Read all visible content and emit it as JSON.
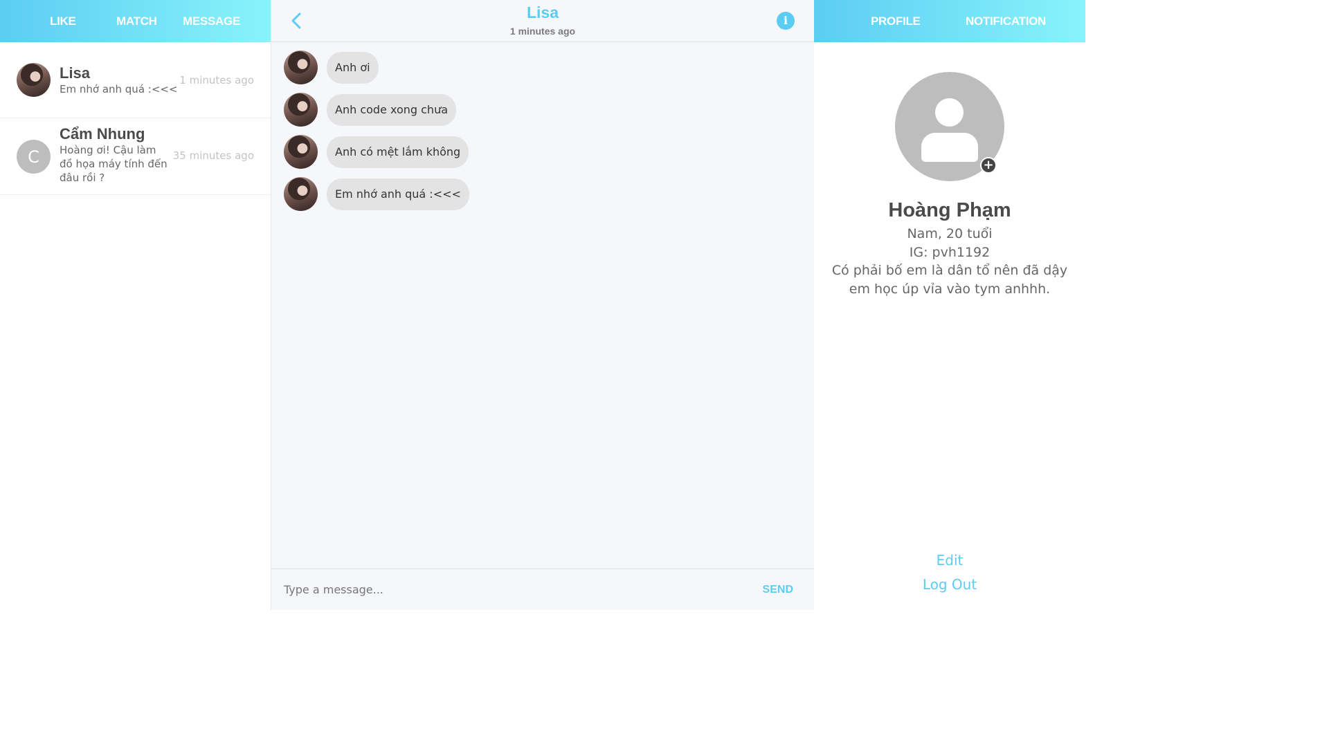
{
  "nav_left": {
    "like": "LIKE",
    "match": "MATCH",
    "message": "MESSAGE"
  },
  "nav_right": {
    "profile": "PROFILE",
    "notification": "NOTIFICATION"
  },
  "conversations": [
    {
      "name": "Lisa",
      "last_message": "Em nhớ anh quá :<<<",
      "time": "1 minutes ago",
      "avatar": "photo"
    },
    {
      "name": "Cẩm Nhung",
      "last_message": "Hoàng ơi! Cậu làm đồ họa máy tính đến đâu rồi ?",
      "time": "35 minutes ago",
      "avatar_letter": "C"
    }
  ],
  "chat": {
    "title": "Lisa",
    "subtitle": "1 minutes ago",
    "messages": [
      {
        "text": "Anh ơi"
      },
      {
        "text": "Anh code xong chưa"
      },
      {
        "text": "Anh có mệt lắm không"
      },
      {
        "text": "Em nhớ anh quá :<<<"
      }
    ],
    "input_placeholder": "Type a message...",
    "send_label": "SEND"
  },
  "profile": {
    "name": "Hoàng Phạm",
    "gender_age": "Nam, 20 tuổi",
    "ig": "IG: pvh1192",
    "bio": "Có phải bố em là dân tổ nên đã dậy em học úp vỉa vào tym anhhh.",
    "edit_label": "Edit",
    "logout_label": "Log Out"
  },
  "colors": {
    "accent": "#5bcdf2",
    "gradient_end": "#88f3fb",
    "bubble": "#e3e3e3"
  },
  "icons": {
    "back": "chevron-left-icon",
    "info": "info-icon",
    "add_photo": "plus-circle-icon",
    "default_avatar": "user-silhouette-icon"
  }
}
